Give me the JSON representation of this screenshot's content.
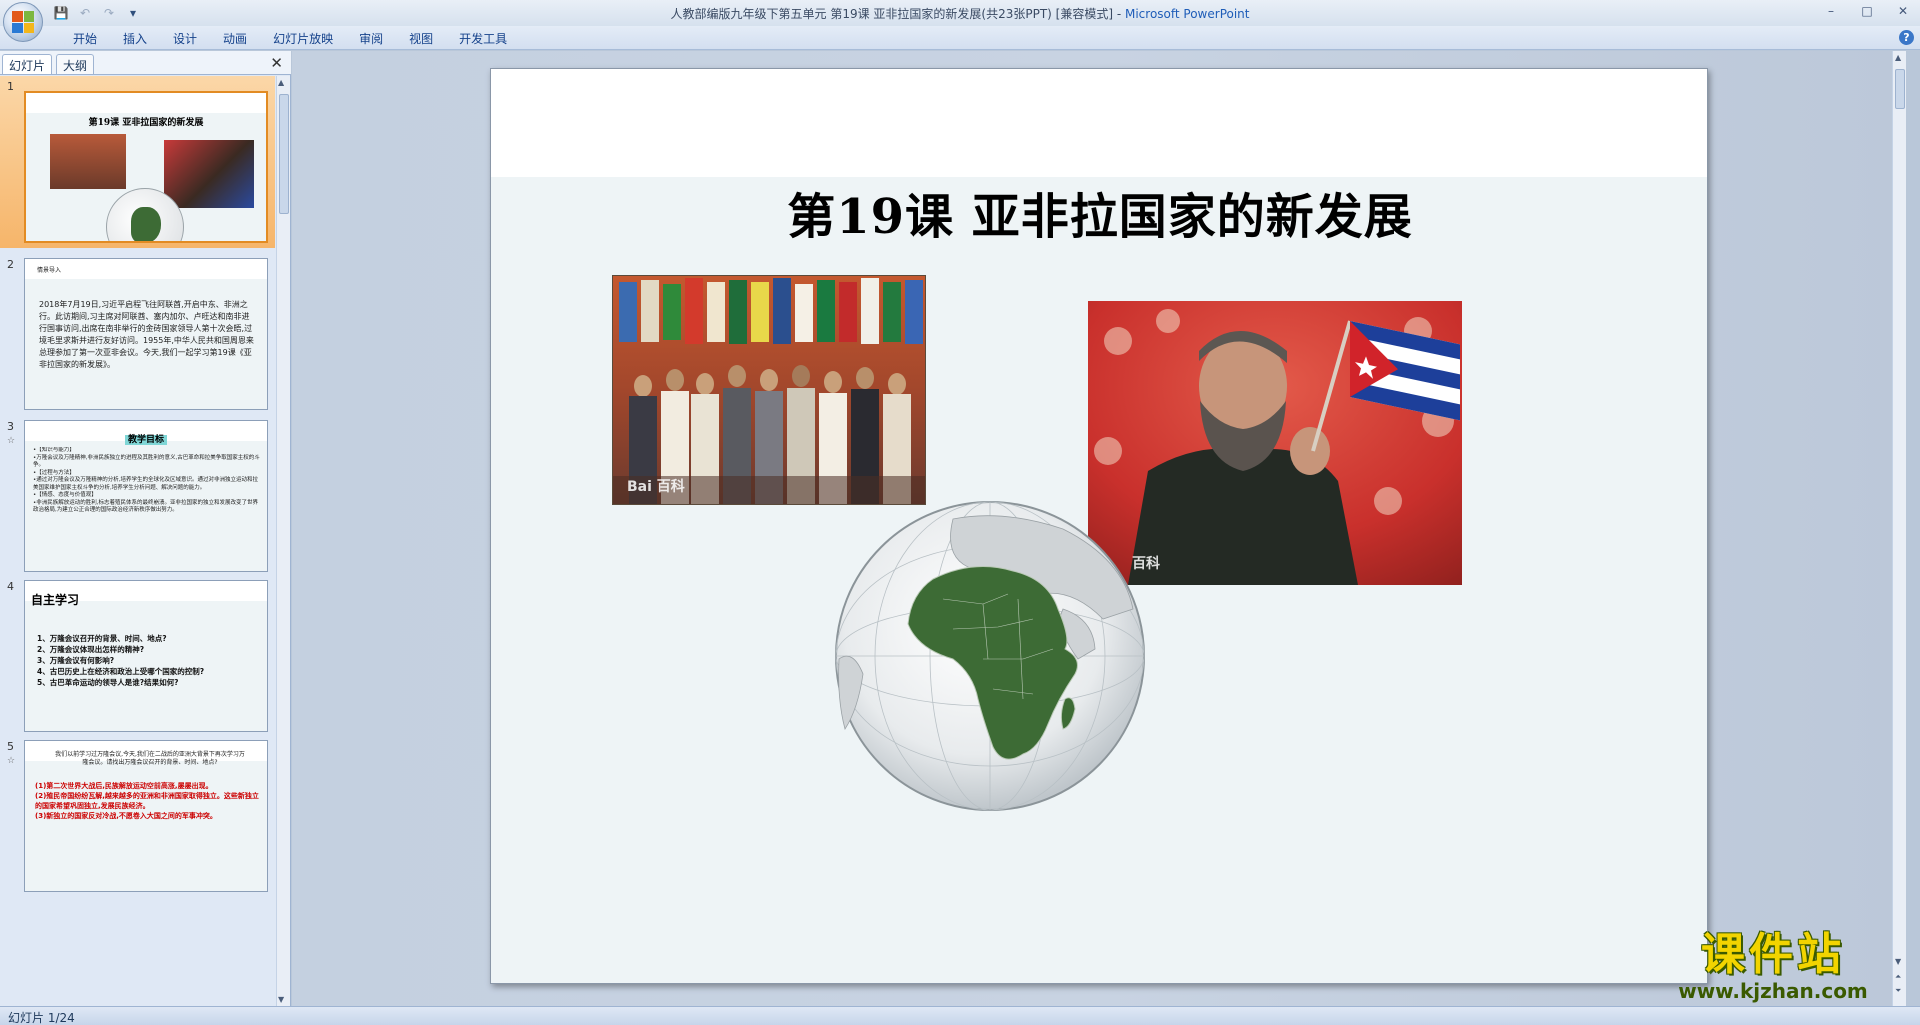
{
  "window": {
    "title_doc": "人教部编版九年级下第五单元   第19课 亚非拉国家的新发展(共23张PPT) [兼容模式]",
    "title_sep": " - ",
    "title_app": "Microsoft PowerPoint",
    "controls": [
      "–",
      "□",
      "✕"
    ]
  },
  "ribbon": {
    "tabs": [
      "开始",
      "插入",
      "设计",
      "动画",
      "幻灯片放映",
      "审阅",
      "视图",
      "开发工具"
    ]
  },
  "pane": {
    "tabs": [
      "幻灯片",
      "大纲"
    ],
    "close": "✕"
  },
  "thumbnails": [
    {
      "num": "1",
      "title": "第19课 亚非拉国家的新发展"
    },
    {
      "num": "2",
      "heading": "情景导入",
      "body": "2018年7月19日,习近平启程飞往阿联酋,开启中东、非洲之行。此访期间,习主席对阿联酋、塞内加尔、卢旺达和南非进行国事访问,出席在南非举行的金砖国家领导人第十次会晤,过境毛里求斯并进行友好访问。1955年,中华人民共和国周恩来总理参加了第一次亚非会议。今天,我们一起学习第19课《亚非拉国家的新发展》。"
    },
    {
      "num": "3",
      "title": "教学目标",
      "lines": [
        "•【知识与能力】",
        "•万隆会议及万隆精神,非洲民族独立的进程及其胜利的意义,古巴革命和拉美争取国家主权的斗争。",
        "•【过程与方法】",
        "•通过对万隆会议及万隆精神的分析,培养学生的全球化及区域意识。通过对非洲独立运动和拉美国家维护国家主权斗争的分析,培养学生分析问题、解决问题的能力。",
        "•【情感、态度与价值观】",
        "•非洲民族解放运动的胜利,标志着殖民体系的最终崩溃。亚非拉国家的独立和发展改变了世界政治格局,为建立公正合理的国际政治经济新秩序做出努力。"
      ]
    },
    {
      "num": "4",
      "title": "自主学习",
      "lines": [
        "1、万隆会议召开的背景、时间、地点?",
        "2、万隆会议体现出怎样的精神?",
        "3、万隆会议有何影响?",
        "4、古巴历史上在经济和政治上受哪个国家的控制?",
        "5、古巴革命运动的领导人是谁?结果如何?"
      ]
    },
    {
      "num": "5",
      "intro": "我们以前学习过万隆会议,今天,我们在二战后的亚洲大背景下再次学习万隆会议。请找出万隆会议召开的背景、时间、地点?",
      "lines": [
        "(1)第二次世界大战后,民族解放运动空前高涨,屡屡出现。",
        "(2)殖民帝国纷纷瓦解,越来越多的亚洲和非洲国家取得独立。这些新独立的国家希望巩固独立,发展民族经济。",
        "(3)新独立的国家反对冷战,不愿卷入大国之间的军事冲突。"
      ]
    }
  ],
  "slide": {
    "title": "第19课 亚非拉国家的新发展",
    "watermark_flags": "Bai 百科",
    "watermark_castro": "百科"
  },
  "status": {
    "slide_counter": "幻灯片 1/24"
  },
  "site_logo": {
    "name": "课件站",
    "url": "www.kjzhan.com"
  },
  "colors": {
    "accent": "#15428b",
    "africa_green": "#3d6b35",
    "selected_thumb": "#f6b56a"
  }
}
